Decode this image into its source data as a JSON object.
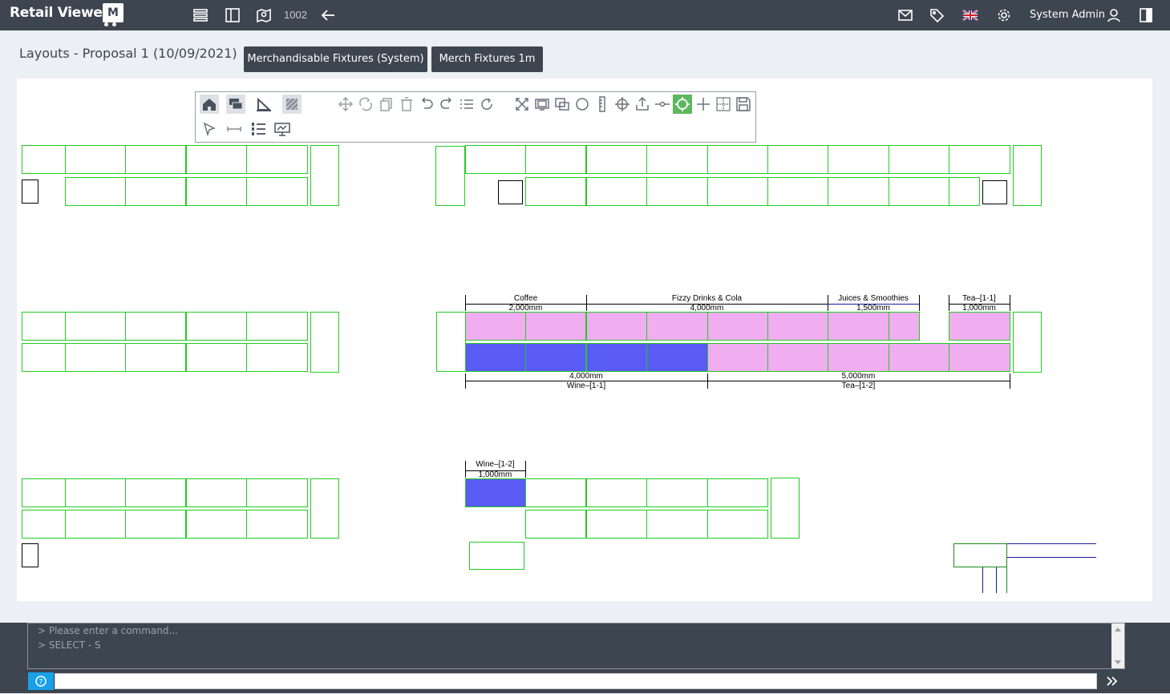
{
  "app": {
    "title": "Retail Viewer",
    "logo_letter": "M"
  },
  "topbar": {
    "store_number": "1002",
    "user_name": "System Admin"
  },
  "page": {
    "title": "Layouts - Proposal 1 (10/09/2021)"
  },
  "buttons": {
    "fixtures_system": "Merchandisable Fixtures (System)",
    "fixtures_1m": "Merch Fixtures 1m"
  },
  "colors": {
    "topbar": "#3d4550",
    "fixture_outline": "#22cc22",
    "pink_fill": "#f0aef0",
    "blue_fill": "#5a5af5",
    "active_tool": "#5cb85c",
    "help": "#1aa0e8"
  },
  "toolbar_icons": {
    "row1": [
      "home-icon",
      "comments-icon",
      "set-square-icon",
      "hatch-icon",
      "move-icon",
      "rotate-icon",
      "copy-icon",
      "delete-icon",
      "undo-icon",
      "redo-icon",
      "list-icon",
      "refresh-icon",
      "fit-screen-icon",
      "screen-icon",
      "duplicate-icon",
      "circle-icon",
      "ruler-icon",
      "crosshair-icon",
      "export-icon",
      "line-point-icon",
      "snap-icon",
      "plus-icon",
      "grid-icon",
      "save-icon"
    ],
    "row2": [
      "pointer-icon",
      "measure-icon",
      "numbered-list-icon",
      "presentation-icon"
    ]
  },
  "dimensions": {
    "top": [
      {
        "label": "Coffee",
        "value": "2,000mm"
      },
      {
        "label": "Fizzy Drinks & Cola",
        "value": "4,000mm"
      },
      {
        "label": "Juices & Smoothies",
        "value": "1,500mm"
      },
      {
        "label": "Tea–[1-1]",
        "value": "1,000mm"
      }
    ],
    "bottom": [
      {
        "label": "Wine–[1-1]",
        "value": "4,000mm"
      },
      {
        "label": "Tea–[1-2]",
        "value": "5,000mm"
      }
    ],
    "wine2": {
      "label": "Wine–[1-2]",
      "value": "1,000mm"
    }
  },
  "command": {
    "placeholder": "> Please enter a command...",
    "last": "> SELECT - S",
    "input_value": ""
  }
}
